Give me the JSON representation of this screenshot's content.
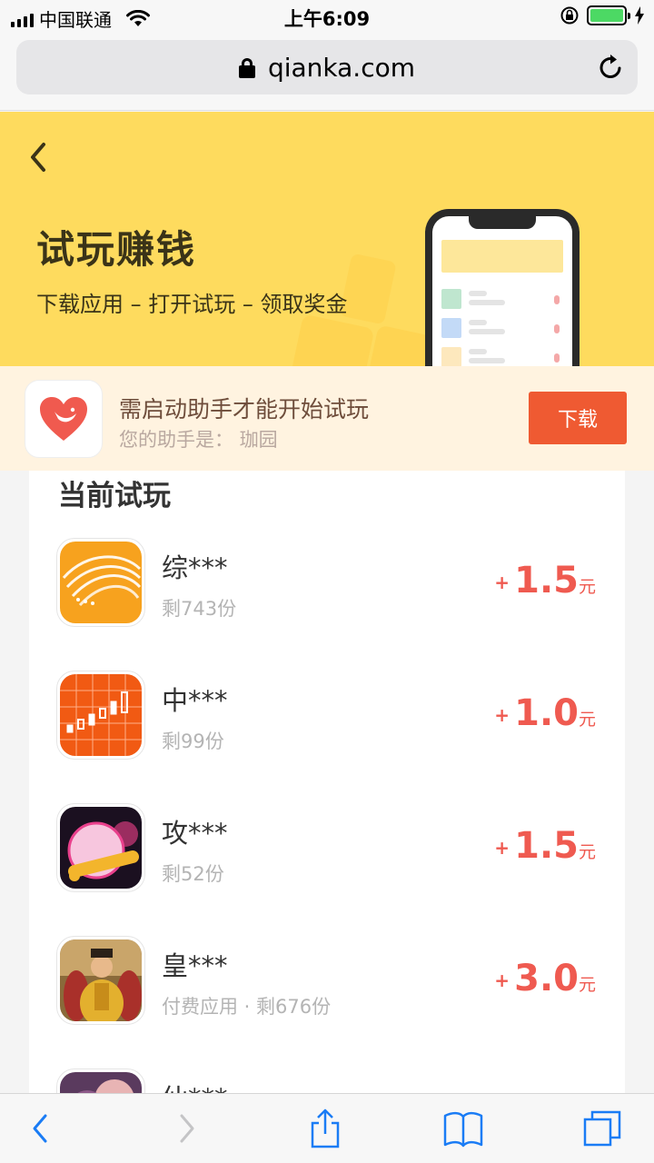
{
  "status_bar": {
    "carrier": "中国联通",
    "time": "上午6:09"
  },
  "browser": {
    "url": "qianka.com"
  },
  "hero": {
    "title": "试玩赚钱",
    "subtitle": "下载应用 – 打开试玩 – 领取奖金"
  },
  "helper": {
    "title": "需启动助手才能开始试玩",
    "subtitle": "您的助手是：  珈园",
    "button_label": "下载"
  },
  "list": {
    "title": "当前试玩",
    "items": [
      {
        "name": "综***",
        "meta": "剩743份",
        "plus": "+",
        "amount": "1.5",
        "unit": "元"
      },
      {
        "name": "中***",
        "meta": "剩99份",
        "plus": "+",
        "amount": "1.0",
        "unit": "元"
      },
      {
        "name": "攻***",
        "meta": "剩52份",
        "plus": "+",
        "amount": "1.5",
        "unit": "元"
      },
      {
        "name": "皇***",
        "meta": "付费应用  ·  剩676份",
        "plus": "+",
        "amount": "3.0",
        "unit": "元"
      },
      {
        "name": "仙***",
        "meta": "",
        "plus": "",
        "amount": "",
        "unit": ""
      }
    ]
  },
  "colors": {
    "hero_bg": "#fedb5e",
    "accent": "#ef5a32",
    "reward": "#ef5a50",
    "ios_blue": "#1a7cf5"
  },
  "icons": [
    "signal-icon",
    "wifi-icon",
    "orientation-lock-icon",
    "battery-icon",
    "charging-icon",
    "lock-icon",
    "reload-icon",
    "back-icon",
    "heart-logo-icon",
    "forward-icon",
    "share-icon",
    "bookmarks-icon",
    "tabs-icon"
  ]
}
